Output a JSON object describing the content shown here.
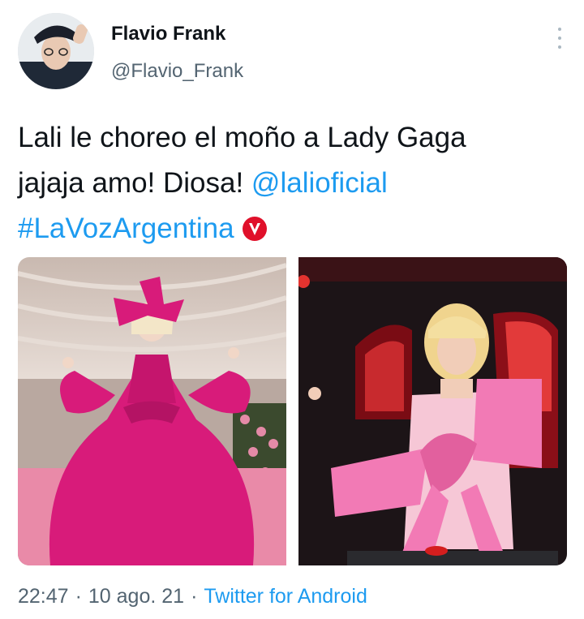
{
  "author": {
    "name": "Flavio Frank",
    "handle": "@Flavio_Frank",
    "avatar_icon": "user-avatar-photo"
  },
  "tweet": {
    "text_plain_1": "Lali le choreo el moño a Lady Gaga",
    "text_plain_2": "jajaja amo! Diosa! ",
    "mention": "@lalioficial",
    "hashtag": "#LaVozArgentina",
    "badge_icon": "la-voz-v-badge-icon"
  },
  "media": [
    {
      "description_icon": "photo-lady-gaga-pink-gown"
    },
    {
      "description_icon": "photo-lali-pink-bow"
    }
  ],
  "meta": {
    "time": "22:47",
    "dot1": "·",
    "date": "10 ago. 21",
    "dot2": "·",
    "source": "Twitter for Android"
  },
  "colors": {
    "link": "#1d9bf0",
    "text": "#0f1419",
    "secondary": "#536471",
    "badge": "#e0102a",
    "gown_pink": "#d81b7a",
    "bow_pink": "#f27ab5"
  }
}
